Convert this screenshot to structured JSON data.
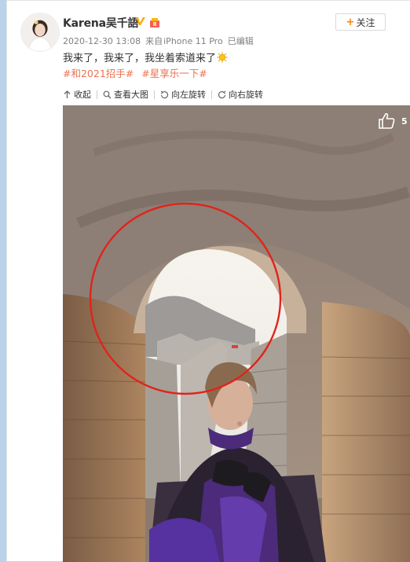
{
  "user": {
    "name": "Karena吴千語"
  },
  "follow": {
    "plus": "+",
    "label": "关注"
  },
  "meta": {
    "time": "2020-12-30 13:08",
    "from_prefix": "来自",
    "device": "iPhone 11 Pro",
    "edited": "已编辑"
  },
  "post": {
    "text": "我来了，我来了，我坐着索道来了"
  },
  "tags": [
    "#和2021招手#",
    "#星享乐一下#"
  ],
  "toolbar": {
    "collapse": "收起",
    "view_large": "查看大图",
    "rotate_left": "向左旋转",
    "rotate_right": "向右旋转"
  },
  "photo": {
    "likes": "5"
  },
  "colors": {
    "accent": "#eb7350",
    "follow_plus": "#ff8200",
    "annotation_circle": "#e0231c"
  }
}
